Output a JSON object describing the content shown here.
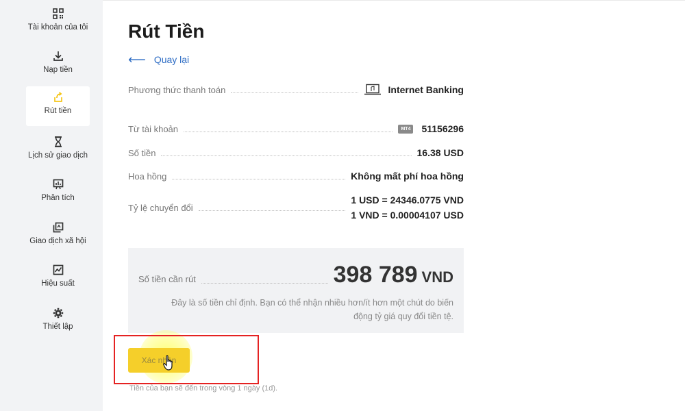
{
  "sidebar": {
    "items": [
      {
        "label": "Tài khoản của tôi",
        "icon": "qr-grid-icon",
        "active": false
      },
      {
        "label": "Nạp tiền",
        "icon": "download-icon",
        "active": false
      },
      {
        "label": "Rút tiền",
        "icon": "withdraw-icon",
        "active": true
      },
      {
        "label": "Lịch sử giao dịch",
        "icon": "hourglass-icon",
        "active": false
      },
      {
        "label": "Phân tích",
        "icon": "chart-board-icon",
        "active": false
      },
      {
        "label": "Giao dịch xã hội",
        "icon": "copy-trade-icon",
        "active": false
      },
      {
        "label": "Hiệu suất",
        "icon": "performance-icon",
        "active": false
      },
      {
        "label": "Thiết lập",
        "icon": "gear-icon",
        "active": false
      }
    ],
    "accent_color": "#f5c518"
  },
  "page": {
    "title": "Rút Tiền",
    "back_label": "Quay lại"
  },
  "details": {
    "payment_method_label": "Phương thức thanh toán",
    "payment_method_value": "Internet Banking",
    "from_account_label": "Từ tài khoản",
    "account_badge": "MT4",
    "account_value": "51156296",
    "amount_label": "Số tiền",
    "amount_value": "16.38 USD",
    "commission_label": "Hoa hồng",
    "commission_value": "Không mất phí hoa hồng",
    "rate_label": "Tỷ lệ chuyển đổi",
    "rate_line1": "1 USD = 24346.0775 VND",
    "rate_line2": "1 VND = 0.00004107 USD"
  },
  "summary": {
    "label": "Số tiền cần rút",
    "amount": "398 789",
    "currency": "VND",
    "note": "Đây là số tiền chỉ định. Bạn có thể nhận nhiều hơn/ít hơn một chút do biến động tỷ giá quy đổi tiền tệ."
  },
  "actions": {
    "confirm_label": "Xác nhận",
    "footnote": "Tiền của bạn sẽ đến trong vòng 1 ngày (1d)."
  },
  "colors": {
    "link": "#2d6cc4",
    "button": "#f5cf2a",
    "annotation": "#e52222"
  }
}
